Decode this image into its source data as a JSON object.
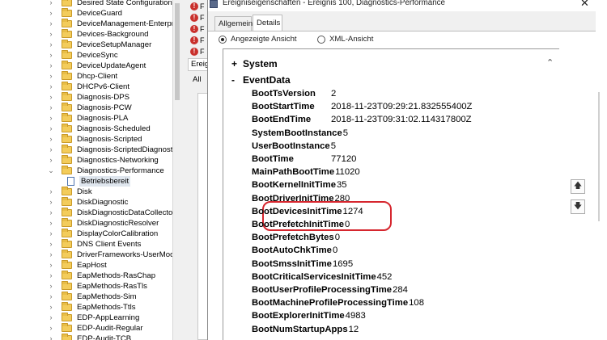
{
  "tree": {
    "items": [
      {
        "label": "Desired State Configuration",
        "expanded": false
      },
      {
        "label": "DeviceGuard",
        "expanded": false
      },
      {
        "label": "DeviceManagement-Enterprise-",
        "expanded": false
      },
      {
        "label": "Devices-Background",
        "expanded": false
      },
      {
        "label": "DeviceSetupManager",
        "expanded": false
      },
      {
        "label": "DeviceSync",
        "expanded": false
      },
      {
        "label": "DeviceUpdateAgent",
        "expanded": false
      },
      {
        "label": "Dhcp-Client",
        "expanded": false
      },
      {
        "label": "DHCPv6-Client",
        "expanded": false
      },
      {
        "label": "Diagnosis-DPS",
        "expanded": false
      },
      {
        "label": "Diagnosis-PCW",
        "expanded": false
      },
      {
        "label": "Diagnosis-PLA",
        "expanded": false
      },
      {
        "label": "Diagnosis-Scheduled",
        "expanded": false
      },
      {
        "label": "Diagnosis-Scripted",
        "expanded": false
      },
      {
        "label": "Diagnosis-ScriptedDiagnosticsP",
        "expanded": false
      },
      {
        "label": "Diagnostics-Networking",
        "expanded": false
      },
      {
        "label": "Diagnostics-Performance",
        "expanded": true
      },
      {
        "label": "Betriebsbereit",
        "child": true
      },
      {
        "label": "Disk",
        "expanded": false
      },
      {
        "label": "DiskDiagnostic",
        "expanded": false
      },
      {
        "label": "DiskDiagnosticDataCollector",
        "expanded": false
      },
      {
        "label": "DiskDiagnosticResolver",
        "expanded": false
      },
      {
        "label": "DisplayColorCalibration",
        "expanded": false
      },
      {
        "label": "DNS Client Events",
        "expanded": false
      },
      {
        "label": "DriverFrameworks-UserMode",
        "expanded": false
      },
      {
        "label": "EapHost",
        "expanded": false
      },
      {
        "label": "EapMethods-RasChap",
        "expanded": false
      },
      {
        "label": "EapMethods-RasTls",
        "expanded": false
      },
      {
        "label": "EapMethods-Sim",
        "expanded": false
      },
      {
        "label": "EapMethods-Ttls",
        "expanded": false
      },
      {
        "label": "EDP-AppLearning",
        "expanded": false
      },
      {
        "label": "EDP-Audit-Regular",
        "expanded": false
      },
      {
        "label": "EDP-Audit-TCB",
        "expanded": false
      }
    ]
  },
  "middle": {
    "error_rows": [
      "F",
      "F",
      "F",
      "F",
      "F"
    ],
    "tab_label": "Ereig",
    "tab2_label": "All"
  },
  "dialog": {
    "title": "Ereigniseigenschaften - Ereignis 100, Diagnostics-Performance",
    "close_glyph": "✕",
    "tabs": [
      "Allgemein",
      "Details"
    ],
    "active_tab": "Details",
    "view_options": {
      "friendly": "Angezeigte Ansicht",
      "xml": "XML-Ansicht",
      "selected": "friendly"
    },
    "sections": {
      "system": {
        "toggle": "+",
        "label": "System"
      },
      "eventdata": {
        "toggle": "-",
        "label": "EventData"
      }
    },
    "properties": [
      {
        "name": "BootTsVersion",
        "value": "2"
      },
      {
        "name": "BootStartTime",
        "value": "2018-11-23T09:29:21.832555400Z"
      },
      {
        "name": "BootEndTime",
        "value": "2018-11-23T09:31:02.114317800Z"
      },
      {
        "name": "SystemBootInstance",
        "value": "5"
      },
      {
        "name": "UserBootInstance",
        "value": "5"
      },
      {
        "name": "BootTime",
        "value": "77120"
      },
      {
        "name": "MainPathBootTime",
        "value": "11020"
      },
      {
        "name": "BootKernelInitTime",
        "value": "35"
      },
      {
        "name": "BootDriverInitTime",
        "value": "280"
      },
      {
        "name": "BootDevicesInitTime",
        "value": "1274"
      },
      {
        "name": "BootPrefetchInitTime",
        "value": "0"
      },
      {
        "name": "BootPrefetchBytes",
        "value": "0"
      },
      {
        "name": "BootAutoChkTime",
        "value": "0"
      },
      {
        "name": "BootSmssInitTime",
        "value": "1695"
      },
      {
        "name": "BootCriticalServicesInitTime",
        "value": "452"
      },
      {
        "name": "BootUserProfileProcessingTime",
        "value": "284"
      },
      {
        "name": "BootMachineProfileProcessingTime",
        "value": "108"
      },
      {
        "name": "BootExplorerInitTime",
        "value": "4983"
      },
      {
        "name": "BootNumStartupApps",
        "value": "12"
      }
    ],
    "highlighted": [
      "BootTime",
      "MainPathBootTime"
    ],
    "highlight_color": "#d6262e",
    "side_buttons": {
      "up_icon": "arrow-up-icon",
      "down_icon": "arrow-down-icon",
      "up_glyph": "🡅",
      "down_glyph": "🡇"
    },
    "scroll_up_glyph": "⌃"
  }
}
